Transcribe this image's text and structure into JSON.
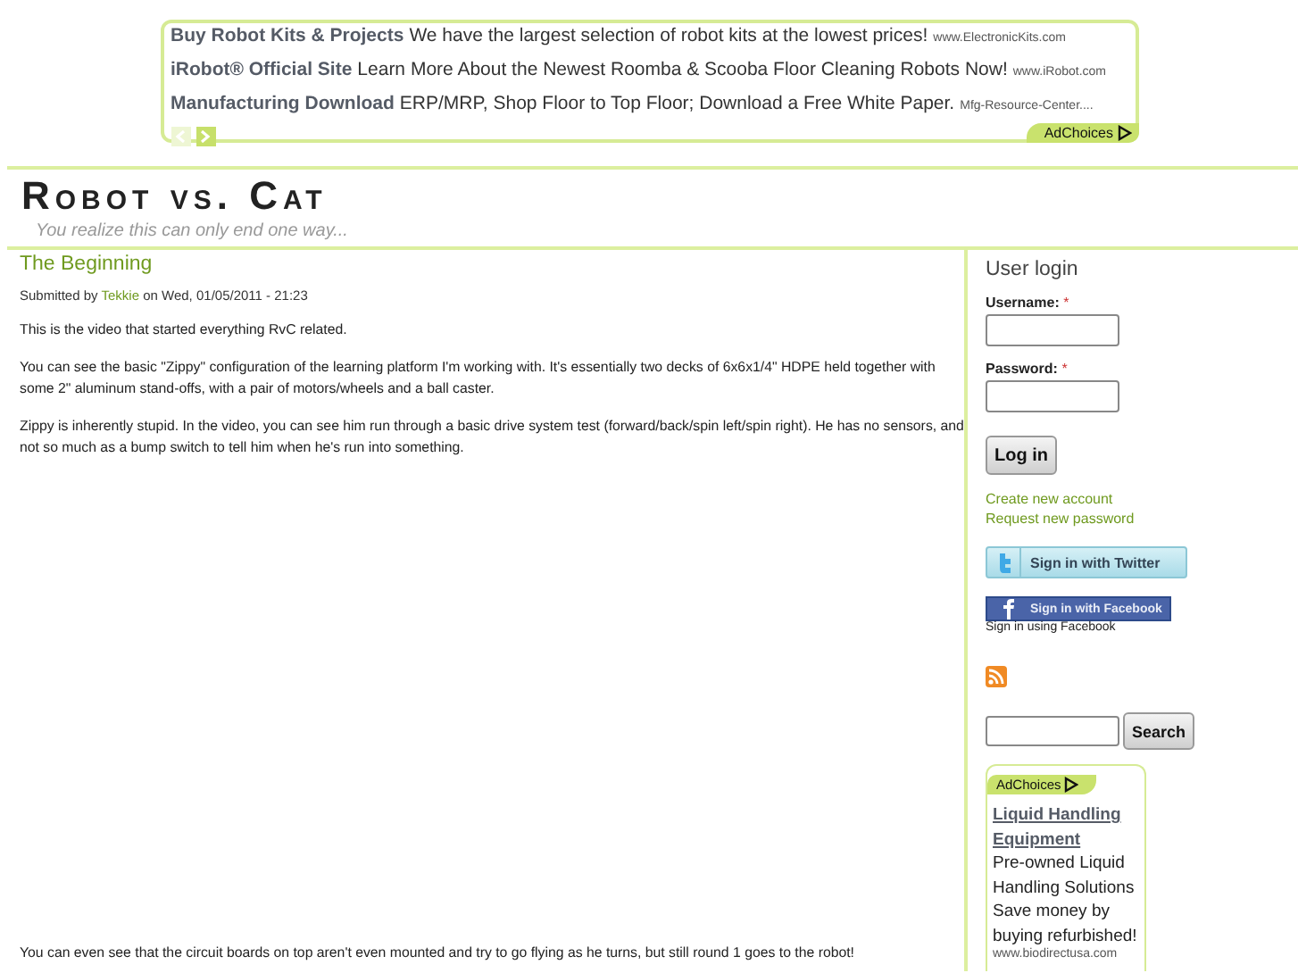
{
  "top_ad": {
    "items": [
      {
        "title": "Buy Robot Kits & Projects",
        "text": "We have the largest selection of robot kits at the lowest prices!",
        "url": "www.ElectronicKits.com"
      },
      {
        "title": "iRobot® Official Site",
        "text": "Learn More About the Newest Roomba & Scooba Floor Cleaning Robots Now!",
        "url": "www.iRobot.com"
      },
      {
        "title": "Manufacturing Download",
        "text": "ERP/MRP, Shop Floor to Top Floor; Download a Free White Paper.",
        "url": "Mfg-Resource-Center...."
      }
    ],
    "prev_disabled": true,
    "next_disabled": false,
    "adchoices": "AdChoices"
  },
  "site": {
    "title": "Robot vs. Cat",
    "slogan": "You realize this can only end one way..."
  },
  "post": {
    "title": "The Beginning",
    "submitted_prefix": "Submitted by",
    "author": "Tekkie",
    "submitted_suffix": "on Wed, 01/05/2011 - 21:23",
    "paragraphs": [
      "This is the video that started everything RvC related.",
      "You can see the basic \"Zippy\" configuration of the learning platform I'm working with. It's essentially two decks of 6x6x1/4\" HDPE held together with some 2\" aluminum stand-offs, with a pair of motors/wheels and a ball caster.",
      "Zippy is inherently stupid. In the video, you can see him run through a basic drive system test (forward/back/spin left/spin right). He has no sensors, and not so much as a bump switch to tell him when he's run into something."
    ],
    "after_video": "You can even see that the circuit boards on top aren't even mounted and try to go flying as he turns, but still round 1 goes to the robot!"
  },
  "sidebar": {
    "login_title": "User login",
    "fields": [
      {
        "label": "Username:",
        "required": "*"
      },
      {
        "label": "Password:",
        "required": "*"
      }
    ],
    "login_button": "Log in",
    "links": [
      "Create new account",
      "Request new password"
    ],
    "twitter": "Sign in with Twitter",
    "facebook": "Sign in with Facebook",
    "facebook_note": "Sign in using Facebook",
    "search_button": "Search",
    "ad": {
      "adchoices": "AdChoices",
      "title": "Liquid Handling Equipment",
      "text": "Pre-owned Liquid Handling Solutions Save money by buying refurbished!",
      "url": "www.biodirectusa.com"
    }
  }
}
